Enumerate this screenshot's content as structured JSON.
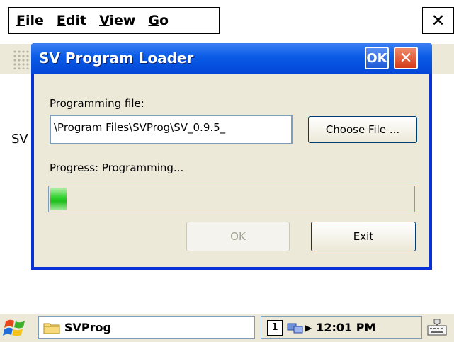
{
  "menubar": {
    "items": [
      "File",
      "Edit",
      "View",
      "Go"
    ],
    "close_glyph": "✕"
  },
  "background_text": "SV",
  "dialog": {
    "title": "SV Program Loader",
    "title_ok": "OK",
    "title_close": "✕",
    "programming_file_label": "Programming file:",
    "programming_file_value": "\\Program Files\\SVProg\\SV_0.9.5_",
    "choose_file_button": "Choose File ...",
    "progress_label": "Progress: Programming...",
    "progress_fraction": 0.045,
    "ok_button": "OK",
    "exit_button": "Exit"
  },
  "taskbar": {
    "task_label": "SVProg",
    "tray_indicator": "1",
    "clock": "12:01 PM"
  },
  "colors": {
    "title_bar": "#0a5be6",
    "progress": "#2dd02a",
    "face": "#ece9d8"
  },
  "icons": [
    "start-flag-icon",
    "folder-icon",
    "network-icon",
    "keyboard-icon",
    "close-icon"
  ]
}
